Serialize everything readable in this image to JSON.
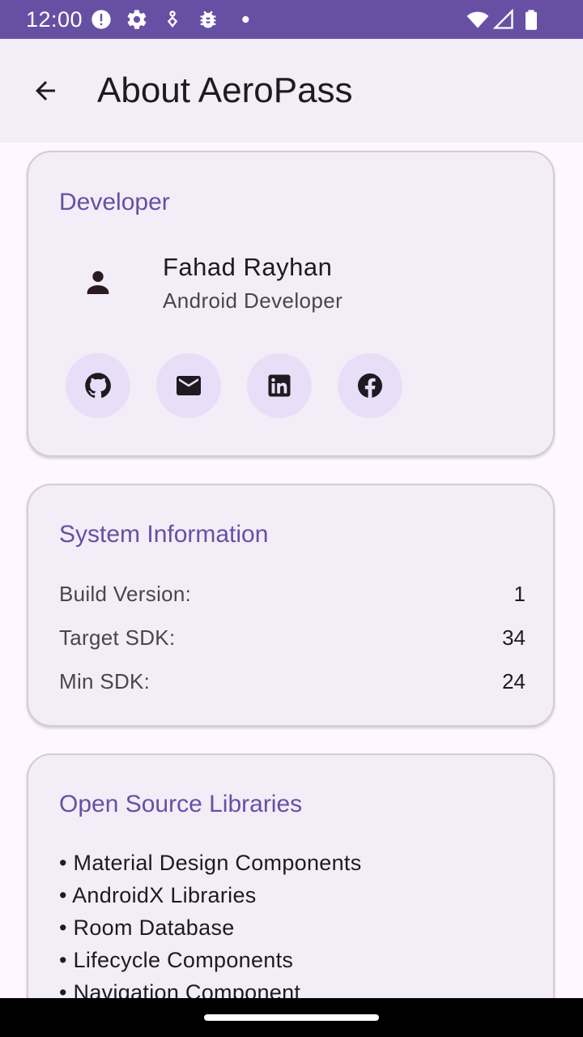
{
  "status_bar": {
    "time": "12:00",
    "background": "#6750A4",
    "icons": [
      "alert-icon",
      "settings-icon",
      "location-icon",
      "bug-icon",
      "dot-icon",
      "wifi-icon",
      "signal-icon",
      "battery-icon"
    ]
  },
  "app_bar": {
    "title": "About AeroPass",
    "back_icon": "arrow-back-icon"
  },
  "developer": {
    "title": "Developer",
    "name": "Fahad Rayhan",
    "role": "Android Developer",
    "socials": [
      "github-icon",
      "email-icon",
      "linkedin-icon",
      "facebook-icon"
    ]
  },
  "system": {
    "title": "System Information",
    "rows": [
      {
        "label": "Build Version:",
        "value": "1"
      },
      {
        "label": "Target SDK:",
        "value": "34"
      },
      {
        "label": "Min SDK:",
        "value": "24"
      }
    ]
  },
  "libraries": {
    "title": "Open Source Libraries",
    "items": [
      "• Material Design Components",
      "• AndroidX Libraries",
      "• Room Database",
      "• Lifecycle Components",
      "• Navigation Component"
    ]
  },
  "colors": {
    "primary": "#6750A4",
    "surface": "#FEF7FF",
    "card": "#F3EDF7",
    "social_bg": "#E8DEF8",
    "on_surface": "#1D1B20"
  }
}
